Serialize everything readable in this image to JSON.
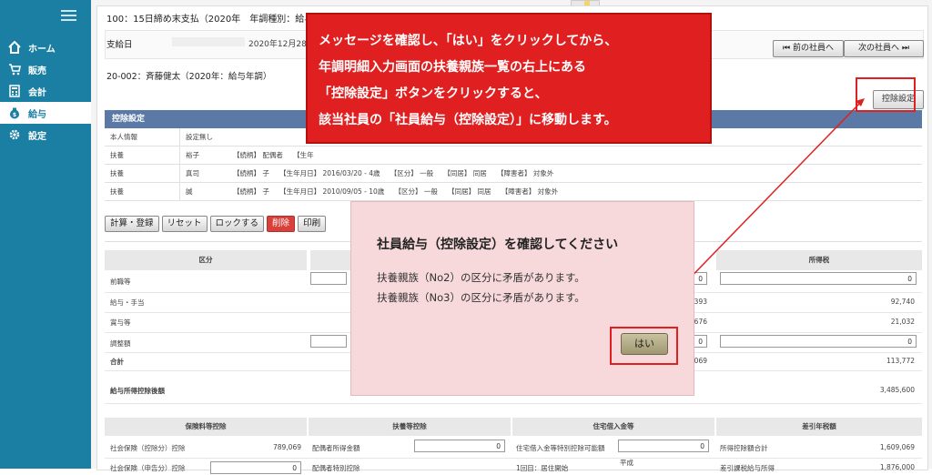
{
  "sidebar": {
    "items": [
      {
        "label": "ホーム",
        "icon": "home-icon"
      },
      {
        "label": "販売",
        "icon": "cart-icon"
      },
      {
        "label": "会計",
        "icon": "calculator-icon"
      },
      {
        "label": "給与",
        "icon": "money-bag-icon"
      },
      {
        "label": "設定",
        "icon": "gear-icon"
      }
    ],
    "active": "給与"
  },
  "header": {
    "title": "100：15日締め末支払（2020年",
    "title_suffix": "年調種別：給与年調）",
    "pay_date_label": "支給日",
    "pay_date_value": "2020年12月28日",
    "prev_button": "⏮ 前の社員へ",
    "next_button": "次の社員へ ⏭",
    "employee": "20-002：斉藤健太（2020年：給与年調）"
  },
  "deduction": {
    "settings_button": "控除設定",
    "section_title": "控除設定",
    "rows": [
      {
        "c1": "本人情報",
        "c2": "設定無し",
        "c3": ""
      },
      {
        "c1": "扶養",
        "c2": "裕子",
        "c3": "【続柄】 配偶者　　【生年"
      },
      {
        "c1": "扶養",
        "c2": "真司",
        "c3": "【続柄】 子　　【生年月日】 2016/03/20 - 4歳　　【区分】 一般　　【同居】 同居　　【障害者】 対象外"
      },
      {
        "c1": "扶養",
        "c2": "誠",
        "c3": "【続柄】 子　　【生年月日】 2010/09/05 - 10歳　　【区分】 一般　　【同居】 同居　　【障害者】 対象外"
      }
    ]
  },
  "actions": [
    "計算・登録",
    "リセット",
    "ロックする",
    "削除",
    "印刷"
  ],
  "tax_table": {
    "col_kubun": "区分",
    "col_income_tax": "所得税",
    "rows": [
      {
        "label": "前職等",
        "mid": "0",
        "right": "0"
      },
      {
        "label": "給与・手当",
        "mid": "393",
        "right": "92,740"
      },
      {
        "label": "賞与等",
        "mid": "676",
        "right": "21,032"
      },
      {
        "label": "調整額",
        "mid": "0",
        "right": "0"
      },
      {
        "label": "合計",
        "mid": "069",
        "right": "113,772"
      }
    ],
    "deduction_after_label": "給与所得控除後額",
    "deduction_after_value": "3,485,600"
  },
  "bottom_table": {
    "heads": [
      "保険料等控除",
      "扶養等控除",
      "住宅借入金等",
      "差引年税額"
    ],
    "row1": [
      {
        "label": "社会保険（控除分）控除",
        "value": "789,069"
      },
      {
        "label": "配偶者所得金額",
        "value": "0"
      },
      {
        "label": "住宅借入金等特別控除可能額",
        "value": "0"
      },
      {
        "label": "所得控除額合計",
        "value": "1,609,069"
      }
    ],
    "row2": [
      {
        "label": "社会保険（申告分）控除",
        "value": "0"
      },
      {
        "label": "配偶者特別控除",
        "value": ""
      },
      {
        "label": "1回目：居住開始",
        "value": "平成"
      },
      {
        "label": "差引課税給与所得",
        "value": "1,876,000"
      }
    ]
  },
  "callout": {
    "lines": [
      "メッセージを確認し、「はい」をクリックしてから、",
      "年調明細入力画面の扶養親族一覧の右上にある",
      "「控除設定」ボタンをクリックすると、",
      "該当社員の「社員給与（控除設定）」に移動します。"
    ]
  },
  "dialog": {
    "title": "社員給与（控除設定）を確認してください",
    "messages": [
      "扶養親族（No2）の区分に矛盾があります。",
      "扶養親族（No3）の区分に矛盾があります。"
    ],
    "yes_button": "はい"
  },
  "colors": {
    "sidebar": "#1a7fa3",
    "section_head": "#5a79a6",
    "callout": "#e02020",
    "dialog_bg": "#f7d9dc",
    "delete_button": "#d9403a"
  }
}
